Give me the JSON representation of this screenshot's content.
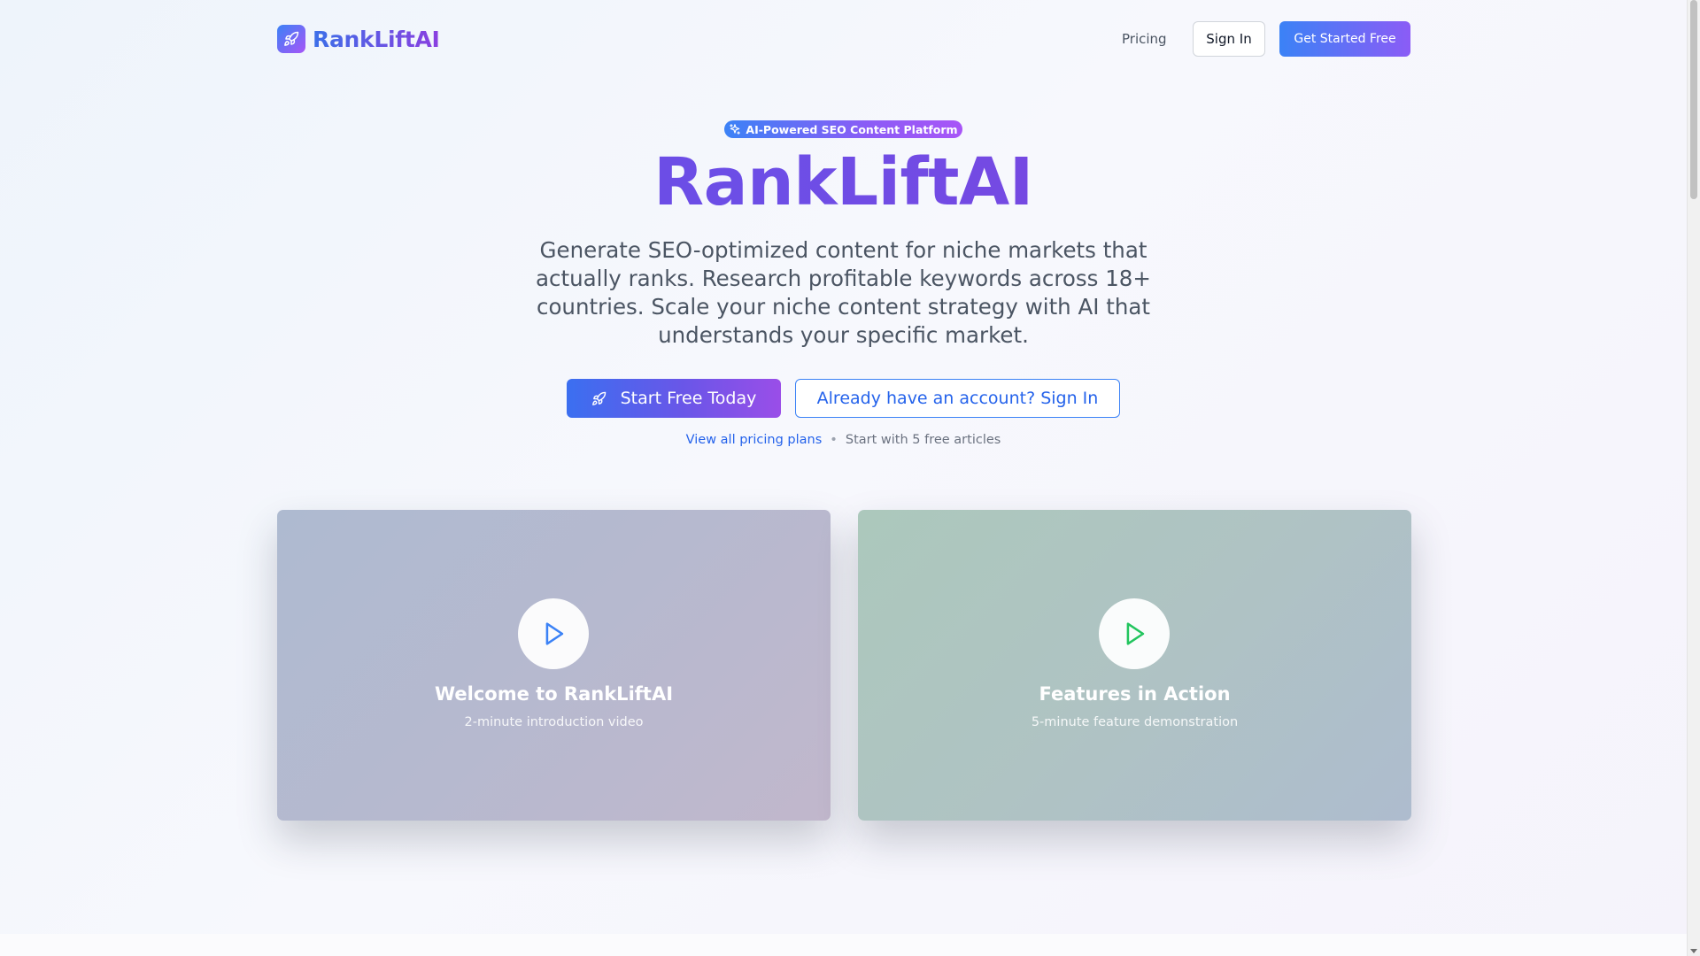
{
  "header": {
    "brand": "RankLiftAI",
    "nav_pricing": "Pricing",
    "nav_signin": "Sign In",
    "nav_cta": "Get Started Free"
  },
  "hero": {
    "badge": "AI-Powered SEO Content Platform",
    "title": "RankLiftAI",
    "subtitle": "Generate SEO-optimized content for niche markets that actually ranks. Research profitable keywords across 18+ countries. Scale your niche content strategy with AI that understands your specific market.",
    "primary_button": "Start Free Today",
    "secondary_button": "Already have an account? Sign In",
    "pricing_link": "View all pricing plans",
    "separator": "•",
    "free_note": "Start with 5 free articles"
  },
  "videos": [
    {
      "title": "Welcome to RankLiftAI",
      "subtitle": "2-minute introduction video",
      "icon": "play-icon",
      "icon_color": "#3b82f6"
    },
    {
      "title": "Features in Action",
      "subtitle": "5-minute feature demonstration",
      "icon": "play-icon",
      "icon_color": "#22c55e"
    }
  ],
  "colors": {
    "brand_gradient_start": "#3b82f6",
    "brand_gradient_end": "#a855f7",
    "link": "#2563eb"
  }
}
